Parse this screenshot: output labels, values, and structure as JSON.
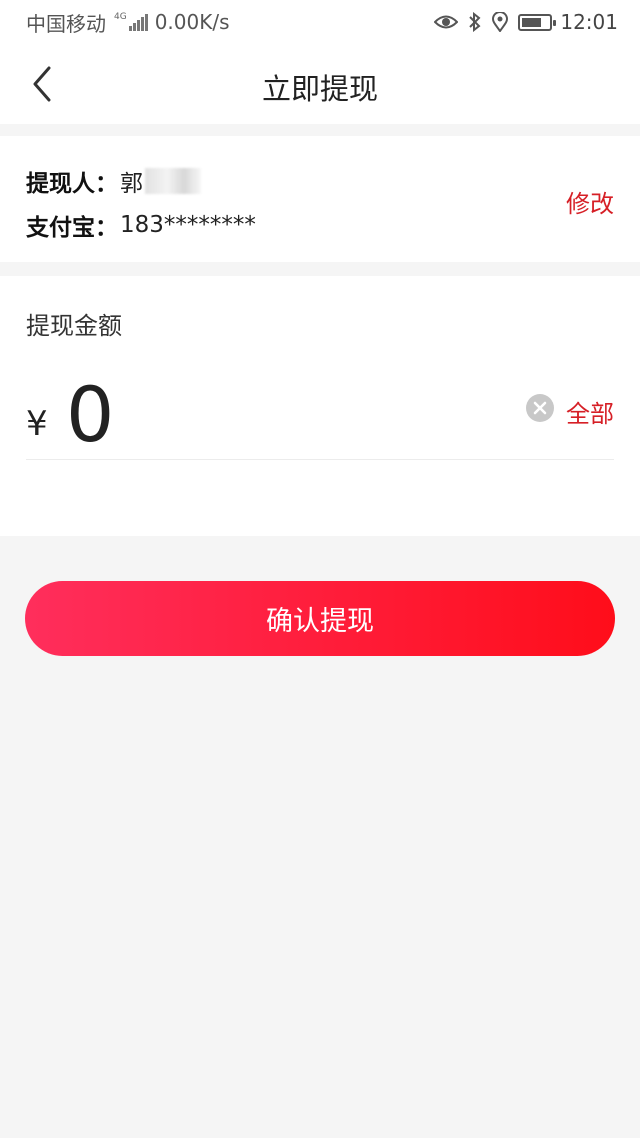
{
  "status_bar": {
    "carrier": "中国移动",
    "network": "4G",
    "speed": "0.00K/s",
    "time": "12:01",
    "icons": [
      "signal-icon",
      "eye-icon",
      "bluetooth-icon",
      "location-icon",
      "battery-icon"
    ]
  },
  "header": {
    "title": "立即提现",
    "back_icon": "chevron-left-icon"
  },
  "account": {
    "name_label": "提现人：",
    "name_value": "郭",
    "alipay_label": "支付宝：",
    "alipay_value": "183********",
    "modify_label": "修改"
  },
  "amount": {
    "label": "提现金额",
    "currency": "¥",
    "value": "0",
    "clear_icon": "clear-circle-icon",
    "all_label": "全部"
  },
  "confirm": {
    "label": "确认提现"
  },
  "colors": {
    "accent": "#d61f26",
    "button_gradient_start": "#ff2e5c",
    "button_gradient_end": "#ff0d1a",
    "background": "#f5f5f5"
  }
}
